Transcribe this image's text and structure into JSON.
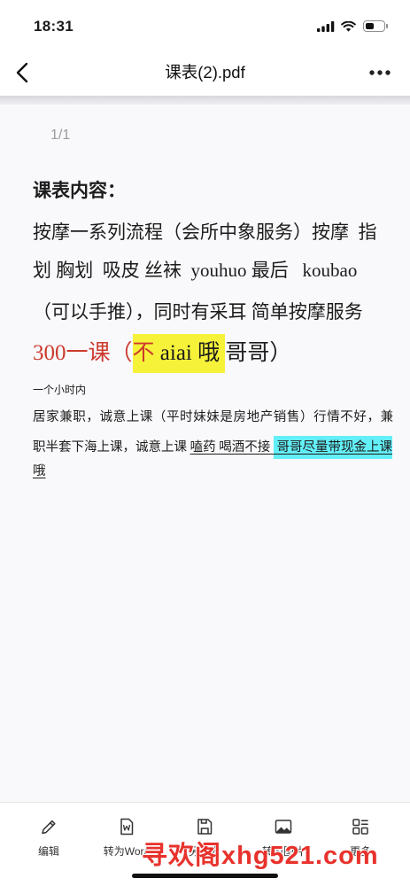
{
  "status_bar": {
    "time": "18:31",
    "signal_icon": "cellular-signal-icon",
    "wifi_icon": "wifi-icon",
    "battery_icon": "battery-icon",
    "battery_level": 0.45
  },
  "nav": {
    "back_icon": "chevron-left-icon",
    "title": "课表(2).pdf",
    "more_icon": "more-horizontal-icon"
  },
  "viewer": {
    "page_indicator": "1/1"
  },
  "document": {
    "heading": "课表内容：",
    "paragraph_lines": [
      "按摩一系列流程（会所中象服务）按摩  指",
      "划 胸划  吸皮 丝袜  youhuo 最后   koubao",
      "（可以手推），同时有采耳 简单按摩服务"
    ],
    "price_line": {
      "price": "300一课（",
      "highlight_red": "不",
      "highlight_rest": " aiai 哦 ",
      "tail": "哥哥）"
    },
    "note": "一个小时内",
    "detail_line_1": "居家兼职，诚意上课（平时妹妹是房地产销售）行情不好，兼",
    "detail_line_2": {
      "plain": "职半套下海上课，诚意上课 ",
      "underlined": "嗑药 喝酒不接 ",
      "highlighted": " 哥哥尽量带现金上课"
    },
    "detail_line_3": "哦"
  },
  "toolbar": {
    "items": [
      {
        "label": "编辑",
        "icon": "pencil-icon"
      },
      {
        "label": "转为Word",
        "icon": "word-document-icon"
      },
      {
        "label": "另存为",
        "icon": "save-icon"
      },
      {
        "label": "转为图片",
        "icon": "image-icon"
      },
      {
        "label": "更多",
        "icon": "more-grid-icon"
      }
    ]
  },
  "watermark": "寻欢阁xhg521.com",
  "colors": {
    "red_text": "#cc3a2c",
    "yellow_highlight": "#f6f23a",
    "cyan_highlight": "#63eff7",
    "watermark_red": "#e8322c"
  }
}
